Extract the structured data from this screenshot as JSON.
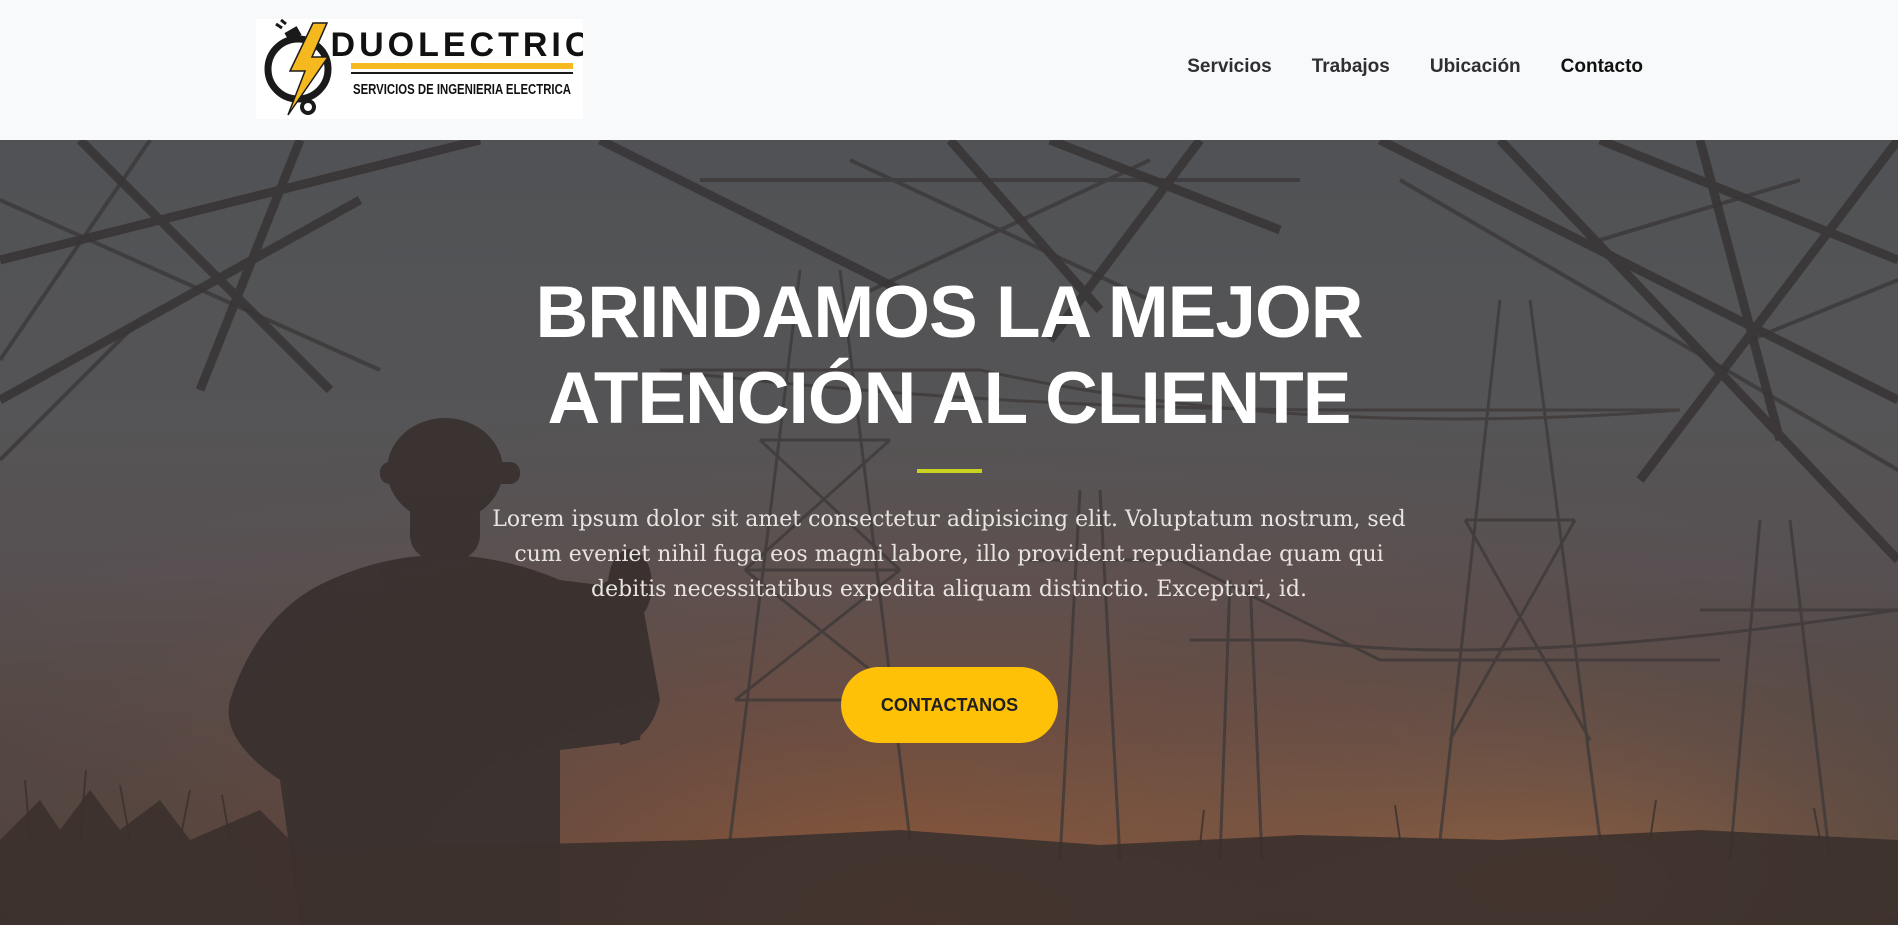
{
  "brand": {
    "name": "DUOLECTRIC",
    "tagline": "SERVICIOS DE INGENIERIA ELECTRICA",
    "logo_icon": "lightning-plug-icon"
  },
  "nav": {
    "items": [
      {
        "label": "Servicios"
      },
      {
        "label": "Trabajos"
      },
      {
        "label": "Ubicación"
      },
      {
        "label": "Contacto"
      }
    ]
  },
  "hero": {
    "title_line1": "BRINDAMOS LA MEJOR",
    "title_line2": "ATENCIÓN AL CLIENTE",
    "text": "Lorem ipsum dolor sit amet consectetur adipisicing elit. Voluptatum nostrum, sed cum eveniet nihil fuga eos magni labore, illo provident repudiandae quam qui debitis necessitatibus expedita aliquam distinctio. Excepturi, id.",
    "button_label": "CONTACTANOS",
    "background_image": "electrician-silhouette-power-towers-sunset"
  },
  "colors": {
    "accent": "#ffc107",
    "divider": "#c9d21e",
    "nav_bg": "#f8f9fa",
    "nav_text": "#2f2f33"
  }
}
